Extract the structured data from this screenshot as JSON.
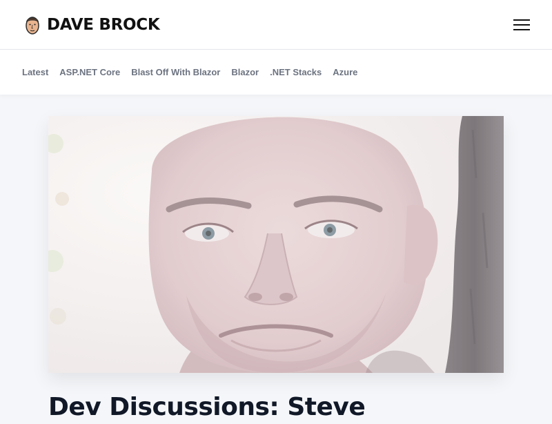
{
  "header": {
    "brand_name": "DAVE BROCK",
    "logo_icon": "avatar-face-icon",
    "menu_icon": "hamburger-menu-icon"
  },
  "nav": {
    "items": [
      {
        "label": "Latest"
      },
      {
        "label": "ASP.NET Core"
      },
      {
        "label": "Blast Off With Blazor"
      },
      {
        "label": "Blazor"
      },
      {
        "label": ".NET Stacks"
      },
      {
        "label": "Azure"
      }
    ]
  },
  "article": {
    "title": "Dev Discussions: Steve",
    "hero_image": "portrait-photo"
  },
  "colors": {
    "page_background": "#f4f6f9",
    "header_background": "#ffffff",
    "brand_text": "#111111",
    "nav_text": "#6c7380",
    "title_text": "#111827"
  }
}
